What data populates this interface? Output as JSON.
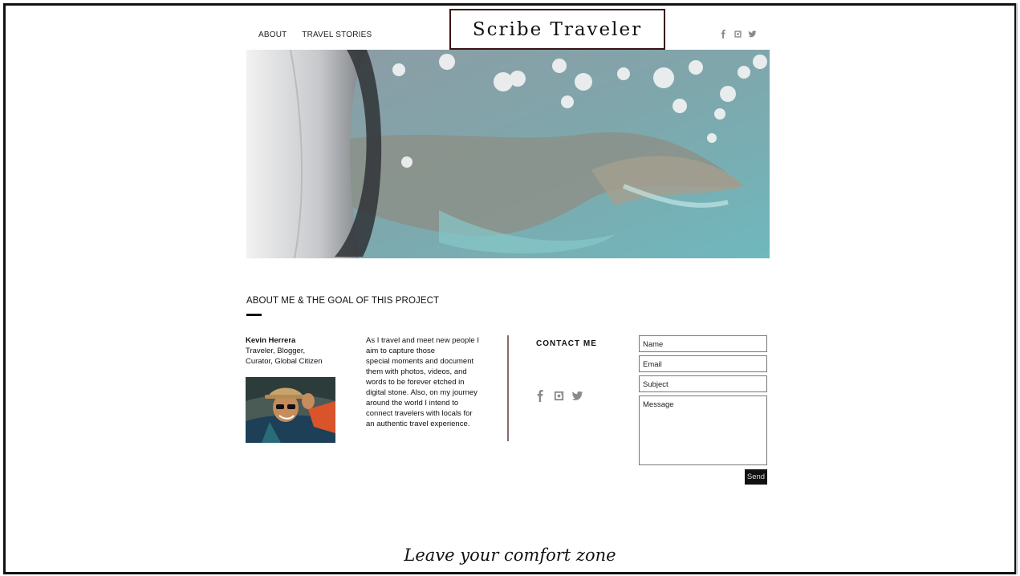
{
  "nav": {
    "items": [
      {
        "label": "ABOUT"
      },
      {
        "label": "TRAVEL STORIES"
      }
    ]
  },
  "header": {
    "logo_text": "Scribe Traveler",
    "social_icons": [
      "facebook-icon",
      "instagram-icon",
      "twitter-icon"
    ]
  },
  "hero": {
    "image": "aerial-island-from-airplane-window"
  },
  "about": {
    "title": "ABOUT ME & THE GOAL OF THIS PROJECT",
    "name": "Kevin Herrera",
    "role_line1": "Traveler, Blogger,",
    "role_line2": "Curator, Global Citizen",
    "bio_lines": [
      "As I travel and meet new people I",
      "aim to capture those",
      "special moments and document",
      "them with photos, videos, and",
      "words to be forever etched in",
      "digital stone. Also, on my journey",
      "around the world I intend to",
      "connect travelers with locals for",
      "an authentic travel experience."
    ]
  },
  "contact": {
    "title": "CONTACT ME",
    "social_icons": [
      "facebook-icon",
      "instagram-icon",
      "twitter-icon"
    ],
    "fields": {
      "name_placeholder": "Name",
      "email_placeholder": "Email",
      "subject_placeholder": "Subject",
      "message_placeholder": "Message"
    },
    "send_label": "Send"
  },
  "footer": {
    "tagline": "Leave your comfort zone"
  },
  "colors": {
    "logo_border": "#3a1414",
    "divider": "#8a6a6a",
    "icon_gray": "#8a8a8a",
    "send_bg": "#111111"
  }
}
